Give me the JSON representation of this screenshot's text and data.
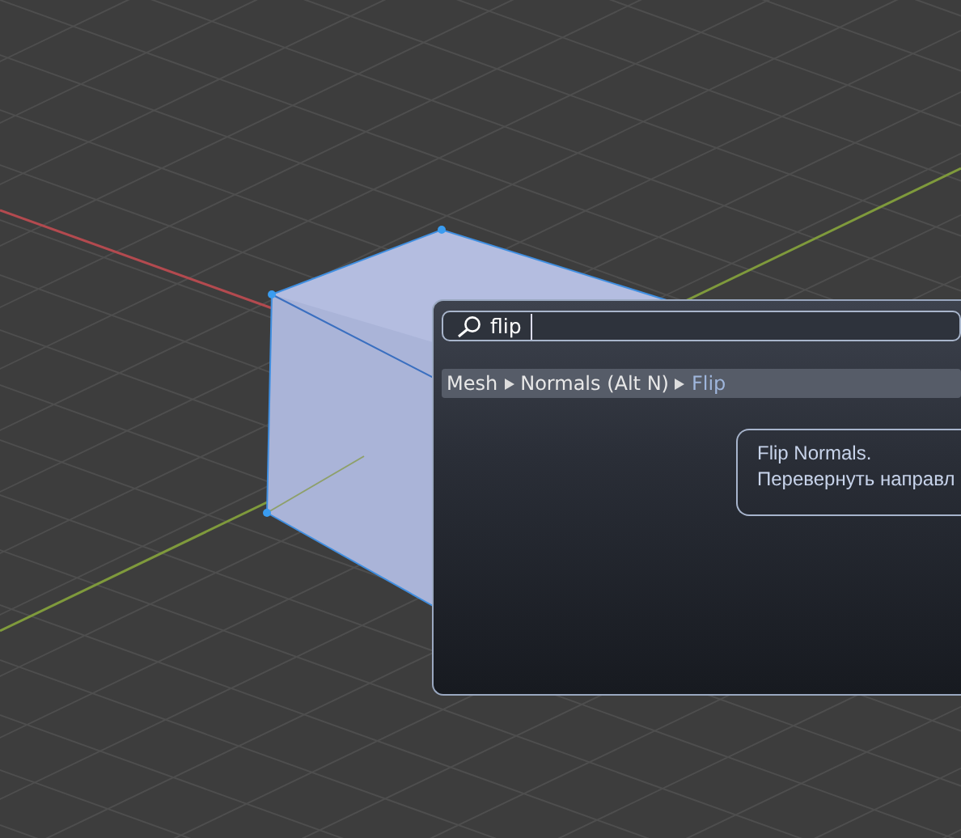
{
  "search": {
    "value": "flip"
  },
  "results": [
    {
      "path": [
        "Mesh",
        "Normals (Alt N)",
        "Flip"
      ],
      "selected": true
    }
  ],
  "tooltip": {
    "lines": [
      "Flip Normals.",
      "Перевернуть направл"
    ]
  }
}
